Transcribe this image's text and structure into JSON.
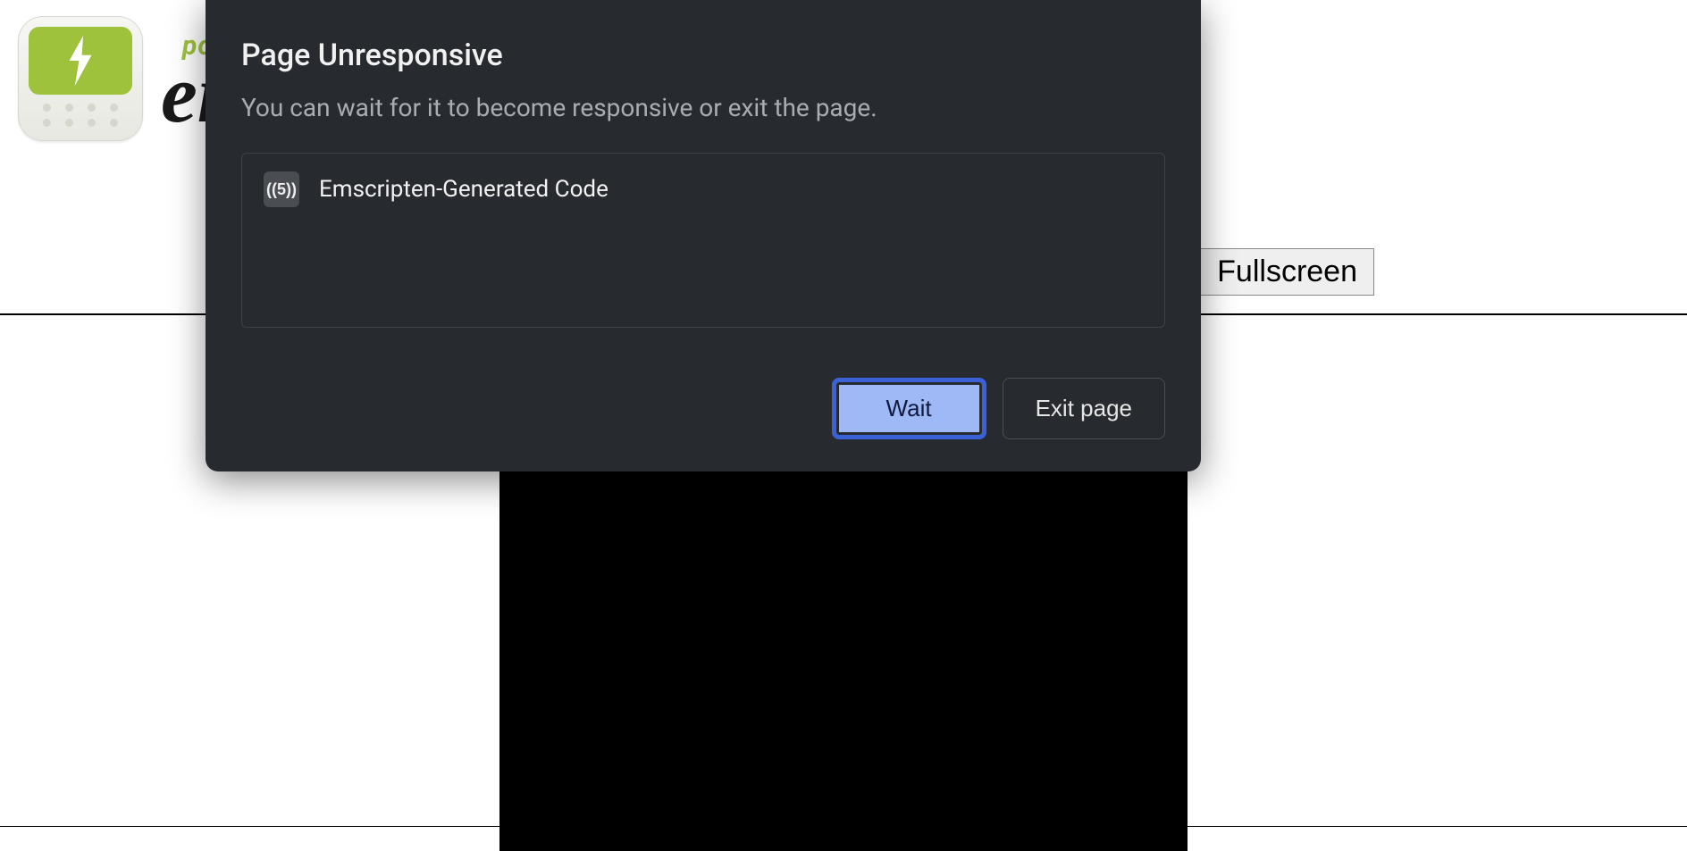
{
  "page": {
    "logo_powered": "powered by",
    "logo_name": "emscripten",
    "fullscreen_label": "Fullscreen"
  },
  "dialog": {
    "title": "Page Unresponsive",
    "subtitle": "You can wait for it to become responsive or exit the page.",
    "items": [
      {
        "label": "Emscripten-Generated Code",
        "favicon_text": "((5))"
      }
    ],
    "wait_label": "Wait",
    "exit_label": "Exit page"
  }
}
